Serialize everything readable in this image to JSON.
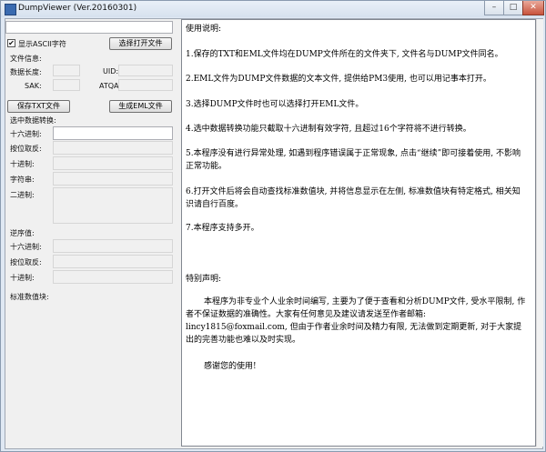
{
  "window": {
    "title": "DumpViewer (Ver.20160301)",
    "buttons": {
      "minimize": "–",
      "maximize": "□",
      "close": "✕"
    }
  },
  "left": {
    "path_value": "",
    "show_ascii_label": "显示ASCII字符",
    "show_ascii_checked": "✔",
    "open_file_button": "选择打开文件",
    "file_info_label": "文件信息:",
    "data_length_label": "数据长度:",
    "uid_label": "UID:",
    "sak_label": "SAK:",
    "atqa_label": "ATQA:",
    "save_txt_button": "保存TXT文件",
    "gen_eml_button": "生成EML文件",
    "selected_convert_label": "选中数据转换:",
    "hex_label": "十六进制:",
    "bitwise_label": "按位取反:",
    "decimal_label": "十进制:",
    "string_label": "字符串:",
    "binary_label": "二进制:",
    "reverse_label": "逆序值:",
    "rev_hex_label": "十六进制:",
    "rev_bitwise_label": "按位取反:",
    "rev_decimal_label": "十进制:",
    "standard_value_label": "标准数值块:"
  },
  "memo": {
    "heading": "使用说明:",
    "item1": "1.保存的TXT和EML文件均在DUMP文件所在的文件夹下, 文件名与DUMP文件同名。",
    "item2": "2.EML文件为DUMP文件数据的文本文件, 提供给PM3使用, 也可以用记事本打开。",
    "item3": "3.选择DUMP文件时也可以选择打开EML文件。",
    "item4": "4.选中数据转换功能只截取十六进制有效字符, 且超过16个字符将不进行转换。",
    "item5": "5.本程序没有进行异常处理, 如遇到程序错误属于正常现象, 点击“继续”即可接着使用, 不影响正常功能。",
    "item6": "6.打开文件后将会自动查找标准数值块, 并将信息显示在左侧, 标准数值块有特定格式, 相关知识请自行百度。",
    "item7": "7.本程序支持多开。",
    "special_heading": "特别声明:",
    "special_body": "本程序为非专业个人业余时间编写, 主要为了便于查看和分析DUMP文件, 受水平限制, 作者不保证数据的准确性。大家有任何意见及建议请发送至作者邮箱: lincy1815@foxmail.com, 但由于作者业余时间及精力有限, 无法做到定期更新, 对于大家提出的完善功能也难以及时实现。",
    "thanks": "感谢您的使用!"
  }
}
